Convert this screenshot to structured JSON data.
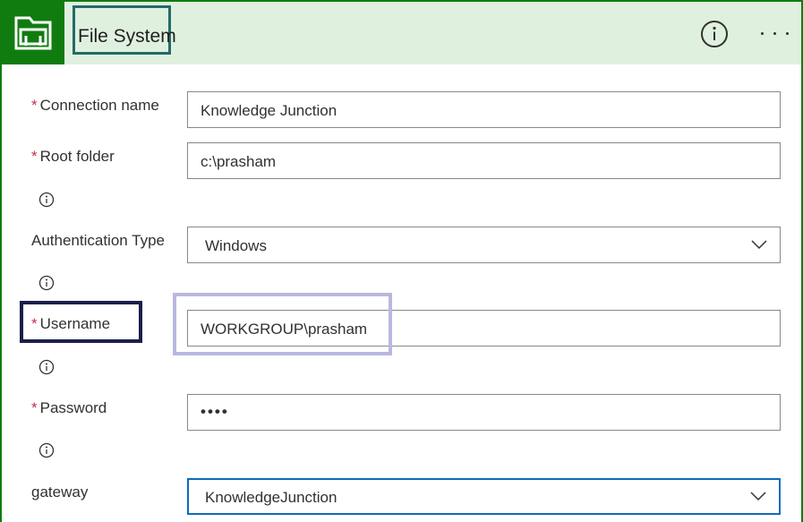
{
  "header": {
    "title": "File System",
    "icon": "file-system-icon",
    "info_icon": "info-icon",
    "more_icon": "more-options-icon"
  },
  "fields": {
    "connection_name": {
      "label": "Connection name",
      "required": "*",
      "value": "Knowledge Junction"
    },
    "root_folder": {
      "label": "Root folder",
      "required": "*",
      "value": "c:\\prasham"
    },
    "authentication_type": {
      "label": "Authentication Type",
      "value": "Windows"
    },
    "username": {
      "label": "Username",
      "required": "*",
      "value": "WORKGROUP\\prasham"
    },
    "password": {
      "label": "Password",
      "required": "*",
      "value": "••••"
    },
    "gateway": {
      "label": "gateway",
      "value": "KnowledgeJunction"
    }
  },
  "colors": {
    "header_background": "#dff0df",
    "brand_green": "#107c10",
    "required_marker": "#c4314b",
    "focus_border": "#0f6cbd",
    "title_highlight": "#236b66",
    "username_highlight": "#1b1f4a",
    "value_highlight": "#b8b8e0"
  }
}
